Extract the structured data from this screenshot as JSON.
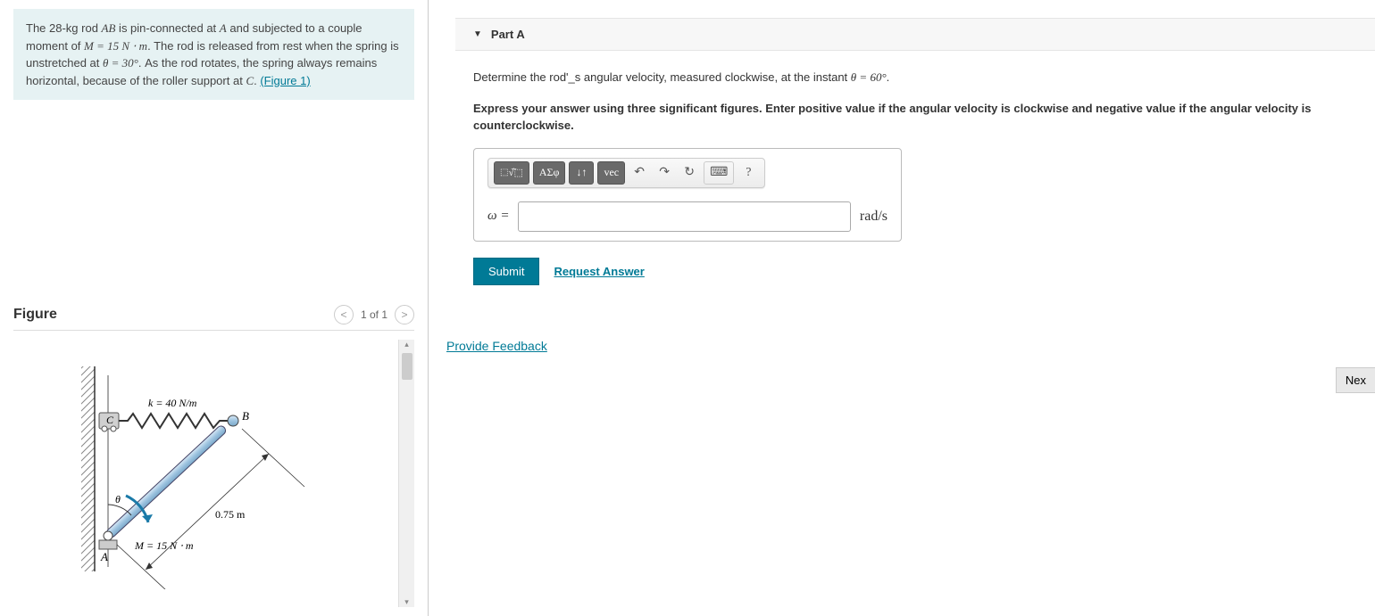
{
  "problem": {
    "text_parts": {
      "p1": "The 28-kg rod ",
      "p2": " is pin-connected at ",
      "p3": " and subjected to a couple moment of ",
      "p4": ". The rod is released from rest when the spring is unstretched at ",
      "p5": ". As the rod rotates, the spring always remains horizontal, because of the roller support at ",
      "p6": ". "
    },
    "math": {
      "AB": "AB",
      "A": "A",
      "M_eq": "M = 15 N ⋅ m",
      "theta30": "θ = 30°",
      "C": "C"
    },
    "figure_link": "(Figure 1)"
  },
  "figure": {
    "title": "Figure",
    "nav_text": "1 of 1",
    "labels": {
      "k": "k = 40 N/m",
      "C": "C",
      "B": "B",
      "A": "A",
      "theta": "θ",
      "length": "0.75 m",
      "moment": "M = 15 N ⋅ m"
    }
  },
  "part": {
    "title": "Part A",
    "question_prefix": "Determine the rod'_s angular velocity, measured clockwise, at the instant ",
    "question_math": "θ = 60°",
    "question_suffix": ".",
    "instructions": "Express your answer using three significant figures. Enter positive value if the angular velocity is clockwise and negative value if the angular velocity is counterclockwise.",
    "toolbar": {
      "templates": "⬚√̅⬚",
      "greek": "ΑΣφ",
      "subscript": "↓↑",
      "vec": "vec",
      "undo": "↶",
      "redo": "↷",
      "reset": "↻",
      "keyboard": "⌨",
      "help": "?"
    },
    "variable": "ω =",
    "units": "rad/s",
    "submit": "Submit",
    "request": "Request Answer"
  },
  "feedback_link": "Provide Feedback",
  "next_button": "Nex"
}
